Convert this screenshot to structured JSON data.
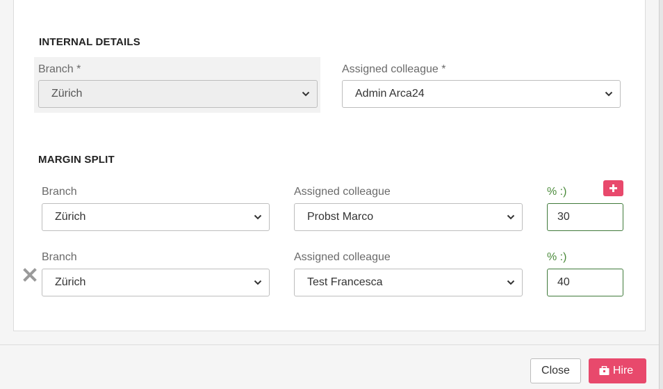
{
  "internal_details": {
    "title": "INTERNAL DETAILS",
    "branch_label": "Branch *",
    "branch_value": "Zürich",
    "colleague_label": "Assigned colleague *",
    "colleague_value": "Admin Arca24"
  },
  "margin_split": {
    "title": "MARGIN SPLIT",
    "rows": [
      {
        "branch_label": "Branch",
        "branch_value": "Zürich",
        "colleague_label": "Assigned colleague",
        "colleague_value": "Probst Marco",
        "percent_label": "% :)",
        "percent_value": "30"
      },
      {
        "branch_label": "Branch",
        "branch_value": "Zürich",
        "colleague_label": "Assigned colleague",
        "colleague_value": "Test Francesca",
        "percent_label": "% :)",
        "percent_value": "40"
      }
    ]
  },
  "footer": {
    "close_label": "Close",
    "hire_label": "Hire"
  },
  "colors": {
    "accent": "#e8496c",
    "input_border": "#3f7a3a"
  }
}
